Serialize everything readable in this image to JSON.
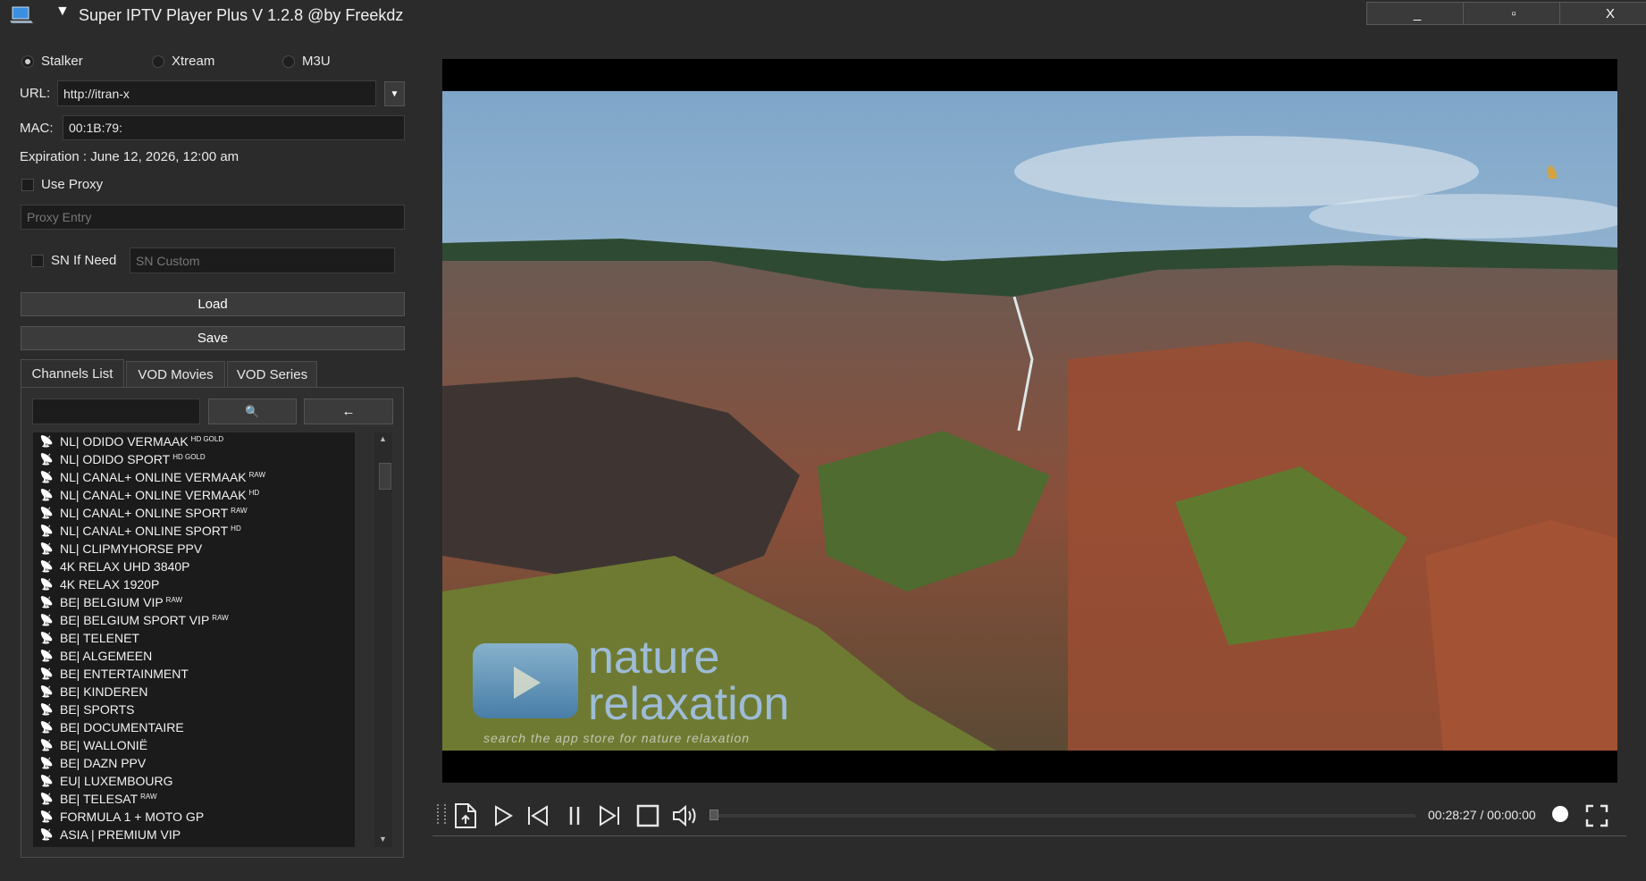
{
  "window": {
    "title": "Super IPTV Player Plus V 1.2.8 @by Freekdz",
    "menu_glyph": "▼",
    "minimize": "_",
    "maximize": "▫",
    "close": "X"
  },
  "connection": {
    "modes": [
      {
        "label": "Stalker",
        "selected": true
      },
      {
        "label": "Xtream",
        "selected": false
      },
      {
        "label": "M3U",
        "selected": false
      }
    ],
    "url_label": "URL:",
    "url_value": "http://itran-x",
    "mac_label": "MAC:",
    "mac_value": "00:1B:79:",
    "expiration": "Expiration : June 12, 2026, 12:00 am",
    "use_proxy_label": "Use Proxy",
    "proxy_placeholder": "Proxy Entry",
    "sn_label": "SN If Need",
    "sn_placeholder": "SN Custom",
    "load_label": "Load",
    "save_label": "Save"
  },
  "tabs": [
    "Channels List",
    "VOD Movies",
    "VOD Series"
  ],
  "channel_search": {
    "search_glyph": "🔍",
    "back_glyph": "←"
  },
  "channels": [
    {
      "name": "NL| ODIDO VERMAAK",
      "tag": "HD GOLD"
    },
    {
      "name": "NL| ODIDO SPORT",
      "tag": "HD GOLD"
    },
    {
      "name": "NL| CANAL+ ONLINE VERMAAK",
      "tag": "RAW"
    },
    {
      "name": "NL| CANAL+ ONLINE VERMAAK",
      "tag": "HD"
    },
    {
      "name": "NL| CANAL+ ONLINE SPORT",
      "tag": "RAW"
    },
    {
      "name": "NL| CANAL+ ONLINE SPORT",
      "tag": "HD"
    },
    {
      "name": "NL| CLIPMYHORSE PPV",
      "tag": ""
    },
    {
      "name": "4K RELAX UHD 3840P",
      "tag": ""
    },
    {
      "name": "4K RELAX 1920P",
      "tag": ""
    },
    {
      "name": "BE| BELGIUM VIP",
      "tag": "RAW"
    },
    {
      "name": "BE| BELGIUM SPORT VIP",
      "tag": "RAW"
    },
    {
      "name": "BE| TELENET",
      "tag": ""
    },
    {
      "name": "BE| ALGEMEEN",
      "tag": ""
    },
    {
      "name": "BE| ENTERTAINMENT",
      "tag": ""
    },
    {
      "name": "BE| KINDEREN",
      "tag": ""
    },
    {
      "name": "BE| SPORTS",
      "tag": ""
    },
    {
      "name": "BE| DOCUMENTAIRE",
      "tag": ""
    },
    {
      "name": "BE| WALLONIË",
      "tag": ""
    },
    {
      "name": "BE| DAZN PPV",
      "tag": ""
    },
    {
      "name": "EU| LUXEMBOURG",
      "tag": ""
    },
    {
      "name": "BE| TELESAT",
      "tag": "RAW"
    },
    {
      "name": "FORMULA 1 + MOTO GP",
      "tag": ""
    },
    {
      "name": "ASIA | PREMIUM VIP",
      "tag": ""
    }
  ],
  "video": {
    "watermark_line1": "nature",
    "watermark_line2": "relaxation",
    "watermark_sub": "search the app store for nature relaxation"
  },
  "player": {
    "time": "00:28:27 / 00:00:00",
    "icons": [
      "open-file-icon",
      "play-icon",
      "previous-icon",
      "pause-icon",
      "next-icon",
      "stop-icon",
      "volume-icon",
      "fullscreen-icon"
    ]
  }
}
